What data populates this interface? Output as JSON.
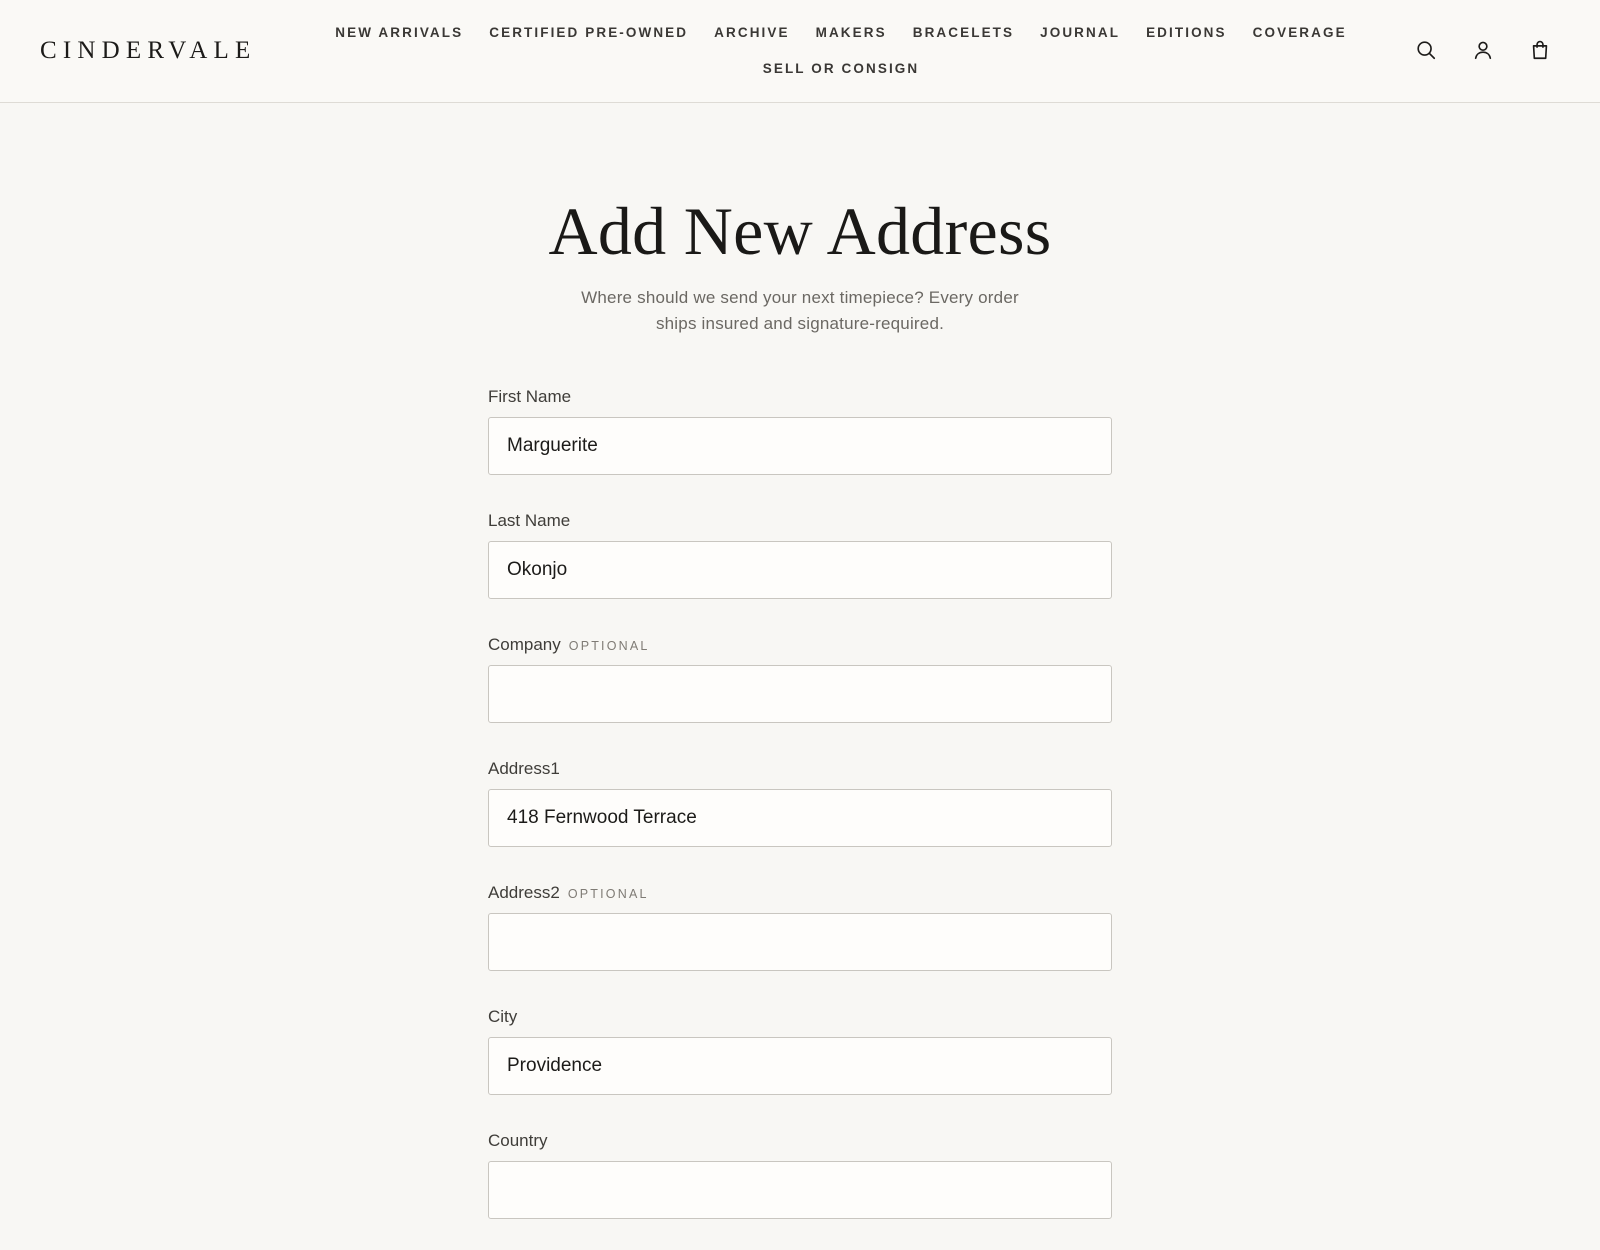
{
  "brand": {
    "logo": "CINDERVALE"
  },
  "nav": {
    "items": [
      "NEW ARRIVALS",
      "CERTIFIED PRE-OWNED",
      "ARCHIVE",
      "MAKERS",
      "BRACELETS",
      "JOURNAL",
      "EDITIONS",
      "COVERAGE",
      "SELL OR CONSIGN"
    ]
  },
  "header_icons": [
    "search-icon",
    "account-icon",
    "bag-icon"
  ],
  "page": {
    "title": "Add New Address",
    "subtitle": "Where should we send your next timepiece? Every order ships insured and signature-required."
  },
  "form": {
    "optional_tag": "OPTIONAL",
    "first_name": {
      "label": "First Name",
      "value": "Marguerite"
    },
    "last_name": {
      "label": "Last Name",
      "value": "Okonjo"
    },
    "company": {
      "label": "Company",
      "value": ""
    },
    "address1": {
      "label": "Address1",
      "value": "418 Fernwood Terrace"
    },
    "address2": {
      "label": "Address2",
      "value": ""
    },
    "city": {
      "label": "City",
      "value": "Providence"
    },
    "country": {
      "label": "Country",
      "value": ""
    }
  },
  "colors": {
    "background": "#f8f7f4",
    "header_background": "#faf9f6",
    "text": "#1c1b19",
    "muted_text": "#6b6863",
    "input_border": "#c9c6c0"
  }
}
